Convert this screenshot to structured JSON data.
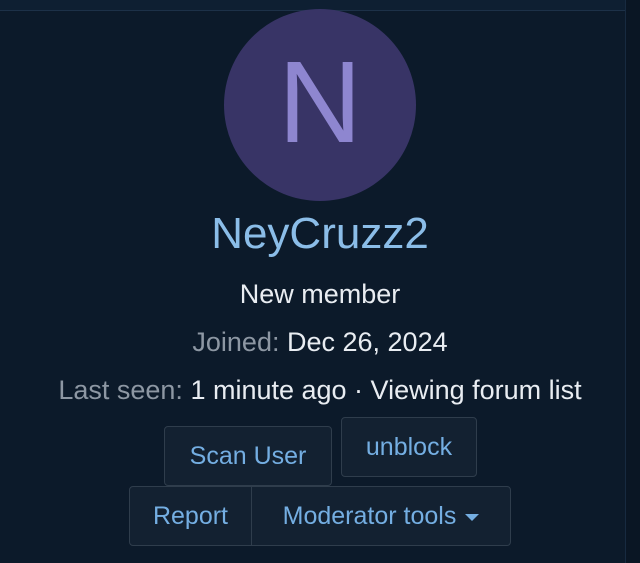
{
  "profile": {
    "avatar_letter": "N",
    "username": "NeyCruzz2",
    "role": "New member",
    "joined_label": "Joined:",
    "joined_value": "Dec 26, 2024",
    "last_seen_label": "Last seen:",
    "last_seen_value": "1 minute ago · Viewing forum list"
  },
  "actions": {
    "scan_user": "Scan User",
    "unblock": "unblock",
    "report": "Report",
    "moderator_tools": "Moderator tools"
  },
  "colors": {
    "background": "#0c1a2a",
    "avatar_bg": "#383466",
    "avatar_letter": "#8e86d0",
    "username": "#8bbde8",
    "link": "#74aee2",
    "muted": "#8d97a3"
  }
}
